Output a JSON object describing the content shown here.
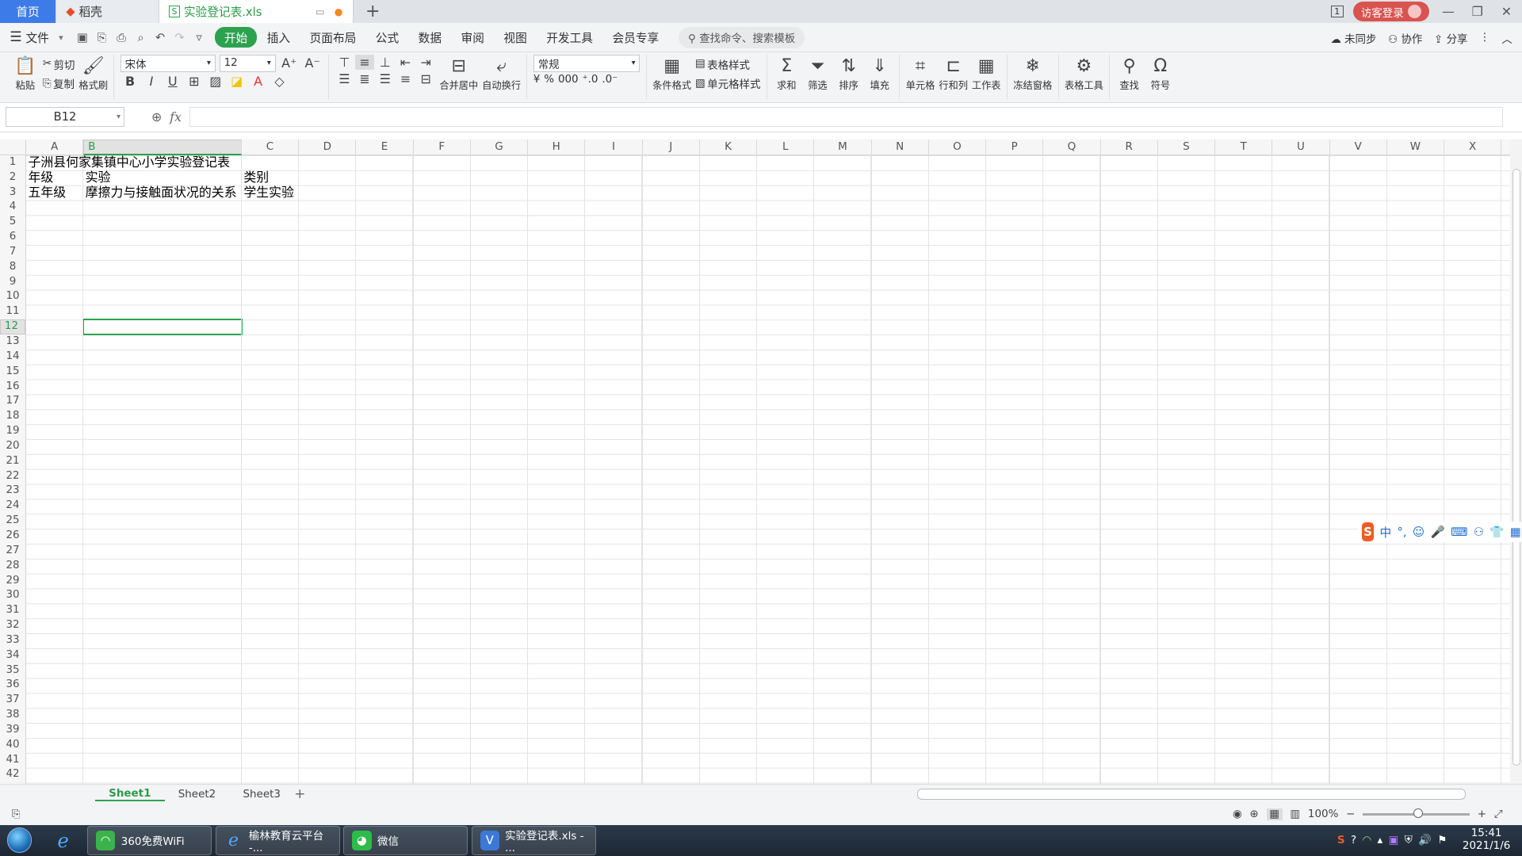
{
  "tabs": [
    {
      "label": "首页"
    },
    {
      "label": "稻壳"
    },
    {
      "label": "实验登记表.xls"
    }
  ],
  "tabbar_right": {
    "login_label": "访客登录"
  },
  "menu": {
    "file": "文件",
    "items": [
      "开始",
      "插入",
      "页面布局",
      "公式",
      "数据",
      "审阅",
      "视图",
      "开发工具",
      "会员专享"
    ],
    "search_placeholder": "查找命令、搜索模板",
    "right": [
      "未同步",
      "协作",
      "分享"
    ]
  },
  "ribbon": {
    "paste": "粘贴",
    "cut": "剪切",
    "copy": "复制",
    "format_painter": "格式刷",
    "font_name": "宋体",
    "font_size": "12",
    "merge_center": "合并居中",
    "auto_wrap": "自动换行",
    "number_format": "常规",
    "currency": "¥",
    "percent": "%",
    "thousands": "000",
    "cond_format": "条件格式",
    "table_style": "表格样式",
    "cell_style": "单元格样式",
    "sum": "求和",
    "filter": "筛选",
    "sort": "排序",
    "fill": "填充",
    "cell": "单元格",
    "rowcol": "行和列",
    "sheet": "工作表",
    "freeze": "冻结窗格",
    "table_tools": "表格工具",
    "find": "查找",
    "symbol": "符号"
  },
  "formula_bar": {
    "name_box": "B12",
    "fx": "fx",
    "content": ""
  },
  "columns": [
    "A",
    "B",
    "C",
    "D",
    "E",
    "F",
    "G",
    "H",
    "I",
    "J",
    "K",
    "L",
    "M",
    "N",
    "O",
    "P",
    "Q",
    "R",
    "S",
    "T",
    "U",
    "V",
    "W",
    "X"
  ],
  "rows": [
    "1",
    "2",
    "3",
    "4",
    "5",
    "6",
    "7",
    "8",
    "9",
    "10",
    "11",
    "12",
    "13",
    "14",
    "15",
    "16",
    "17",
    "18",
    "19",
    "20",
    "21",
    "22",
    "23",
    "24",
    "25",
    "26",
    "27",
    "28",
    "29",
    "30",
    "31",
    "32",
    "33",
    "34",
    "35",
    "36",
    "37",
    "38",
    "39",
    "40",
    "41",
    "42"
  ],
  "selected_cell": "B12",
  "cells": {
    "A1": "子洲县何家集镇中心小学实验登记表",
    "A2": "年级",
    "B2": "实验",
    "C2": "类别",
    "A3": "五年级",
    "B3": "摩擦力与接触面状况的关系",
    "C3": "学生实验"
  },
  "sheets": [
    "Sheet1",
    "Sheet2",
    "Sheet3"
  ],
  "active_sheet": "Sheet1",
  "status": {
    "zoom": "100%"
  },
  "taskbar": {
    "items": [
      "360免费WiFi",
      "榆林教育云平台 -...",
      "微信",
      "实验登记表.xls - ..."
    ],
    "time": "15:41",
    "date": "2021/1/6"
  },
  "ime": {
    "mode": "中"
  },
  "colors": {
    "accent": "#2ca24f",
    "home_tab": "#3c7be8",
    "login": "#d9534f"
  }
}
